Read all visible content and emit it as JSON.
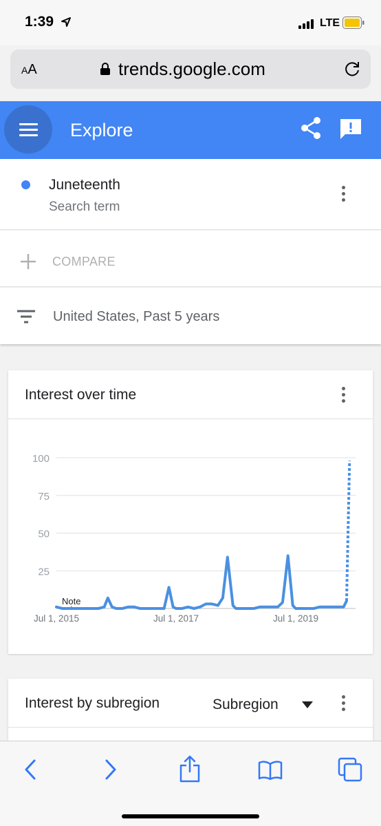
{
  "status_bar": {
    "time": "1:39",
    "network": "LTE"
  },
  "browser": {
    "text_size_label_small": "A",
    "text_size_label_large": "A",
    "url": "trends.google.com"
  },
  "header": {
    "title": "Explore"
  },
  "search_term": {
    "name": "Juneteenth",
    "type": "Search term",
    "color": "#4285f4"
  },
  "compare": {
    "label": "COMPARE"
  },
  "filters": {
    "label": "United States, Past 5 years"
  },
  "interest_over_time": {
    "title": "Interest over time",
    "note_label": "Note"
  },
  "chart_data": {
    "type": "line",
    "title": "Interest over time",
    "xlabel": "",
    "ylabel": "",
    "ylim": [
      0,
      100
    ],
    "y_ticks": [
      "100",
      "75",
      "50",
      "25"
    ],
    "x_ticks": [
      {
        "label": "Jul 1, 2015",
        "x": 2015.5
      },
      {
        "label": "Jul 1, 2017",
        "x": 2017.5
      },
      {
        "label": "Jul 1, 2019",
        "x": 2019.5
      }
    ],
    "xlim": [
      2015.5,
      2020.5
    ],
    "grid": true,
    "series": [
      {
        "color": "#4a90e2",
        "x": [
          2015.5,
          2015.6,
          2015.7,
          2015.8,
          2015.9,
          2016.0,
          2016.1,
          2016.2,
          2016.3,
          2016.36,
          2016.43,
          2016.5,
          2016.6,
          2016.7,
          2016.8,
          2016.9,
          2017.0,
          2017.1,
          2017.2,
          2017.3,
          2017.38,
          2017.45,
          2017.5,
          2017.6,
          2017.7,
          2017.8,
          2017.9,
          2018.0,
          2018.1,
          2018.2,
          2018.28,
          2018.36,
          2018.45,
          2018.5,
          2018.6,
          2018.7,
          2018.8,
          2018.9,
          2019.0,
          2019.1,
          2019.2,
          2019.28,
          2019.37,
          2019.45,
          2019.5,
          2019.6,
          2019.7,
          2019.8,
          2019.9,
          2020.0,
          2020.1,
          2020.2,
          2020.3,
          2020.35
        ],
        "y": [
          1,
          0,
          0,
          0,
          0,
          0,
          0,
          0,
          1,
          7,
          1,
          0,
          0,
          1,
          1,
          0,
          0,
          0,
          0,
          0,
          14,
          1,
          0,
          0,
          1,
          0,
          1,
          3,
          3,
          2,
          7,
          34,
          2,
          0,
          0,
          0,
          0,
          1,
          1,
          1,
          1,
          4,
          35,
          2,
          0,
          0,
          0,
          0,
          1,
          1,
          1,
          1,
          1,
          5
        ],
        "projected": {
          "x": [
            2020.35,
            2020.4
          ],
          "y": [
            5,
            98
          ]
        }
      }
    ],
    "annotations": [
      {
        "label": "Note",
        "x": 2015.75
      }
    ]
  },
  "interest_by_subregion": {
    "title": "Interest by subregion",
    "select_value": "Subregion"
  }
}
